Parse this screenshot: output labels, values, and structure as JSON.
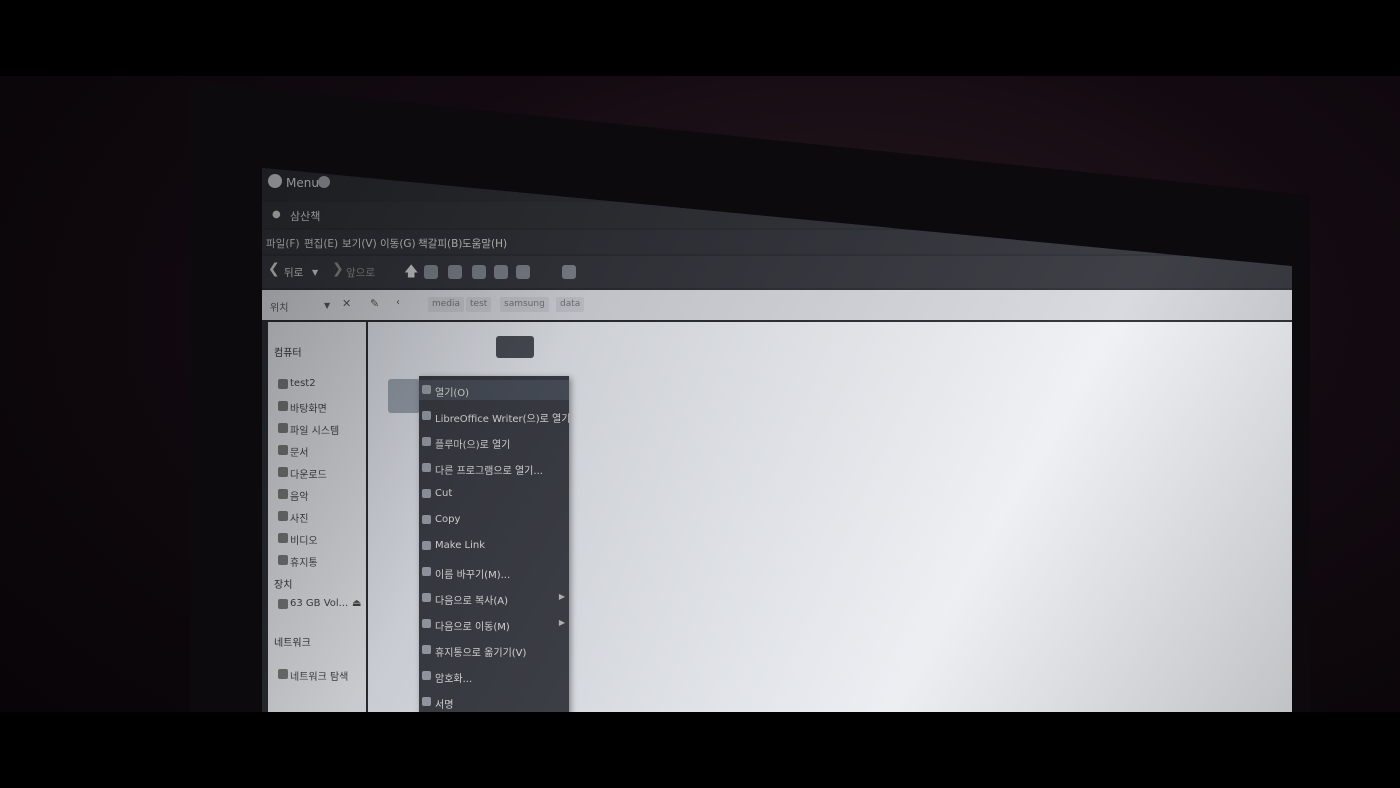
{
  "panel": {
    "menu_label": "Menu"
  },
  "window": {
    "title": "삼산책"
  },
  "menubar": {
    "items": [
      "파일(F)",
      "편집(E)",
      "보기(V)",
      "이동(G)",
      "책갈피(B)",
      "도움말(H)"
    ]
  },
  "toolbar": {
    "back_label": "뒤로",
    "forward_label": "앞으로"
  },
  "locbar": {
    "location_label": "위치",
    "crumbs": [
      "media",
      "test",
      "samsung",
      "data"
    ]
  },
  "sidebar": {
    "computer_header": "컴퓨터",
    "computer_items": [
      "test2",
      "바탕화면",
      "파일 시스템",
      "문서",
      "다운로드",
      "음악",
      "사진",
      "비디오",
      "휴지통"
    ],
    "devices_header": "장치",
    "devices_items": [
      "63 GB Vol..."
    ],
    "network_header": "네트워크",
    "network_items": [
      "네트워크 탐색"
    ]
  },
  "context_menu": {
    "items": [
      {
        "label": "열기(O)",
        "submenu": false
      },
      {
        "label": "LibreOffice Writer(으)로 열기",
        "submenu": false
      },
      {
        "label": "플루마(으)로 열기",
        "submenu": false
      },
      {
        "label": "다른 프로그램으로 열기...",
        "submenu": false
      },
      {
        "label": "Cut",
        "submenu": false
      },
      {
        "label": "Copy",
        "submenu": false
      },
      {
        "label": "Make Link",
        "submenu": false
      },
      {
        "label": "이름 바꾸기(M)...",
        "submenu": false
      },
      {
        "label": "다음으로 복사(A)",
        "submenu": true
      },
      {
        "label": "다음으로 이동(M)",
        "submenu": true
      },
      {
        "label": "휴지통으로 옮기기(V)",
        "submenu": false
      },
      {
        "label": "암호화...",
        "submenu": false
      },
      {
        "label": "서명",
        "submenu": false
      }
    ]
  },
  "colors": {
    "menu_bg": "#3b3e45",
    "content_bg": "#e8ebf0",
    "panel_bg": "#2b2d31"
  }
}
